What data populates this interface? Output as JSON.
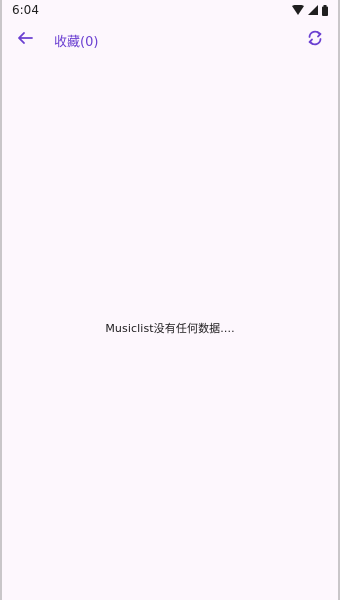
{
  "status_bar": {
    "time": "6:04",
    "icons": [
      "wifi-icon",
      "cell-signal-icon",
      "battery-icon"
    ]
  },
  "app_bar": {
    "back_icon": "arrow-left-icon",
    "title": "收藏(0)",
    "refresh_icon": "sync-icon",
    "accent_color": "#6a3fd1"
  },
  "content": {
    "empty_message": "Musiclist没有任何数据...."
  }
}
